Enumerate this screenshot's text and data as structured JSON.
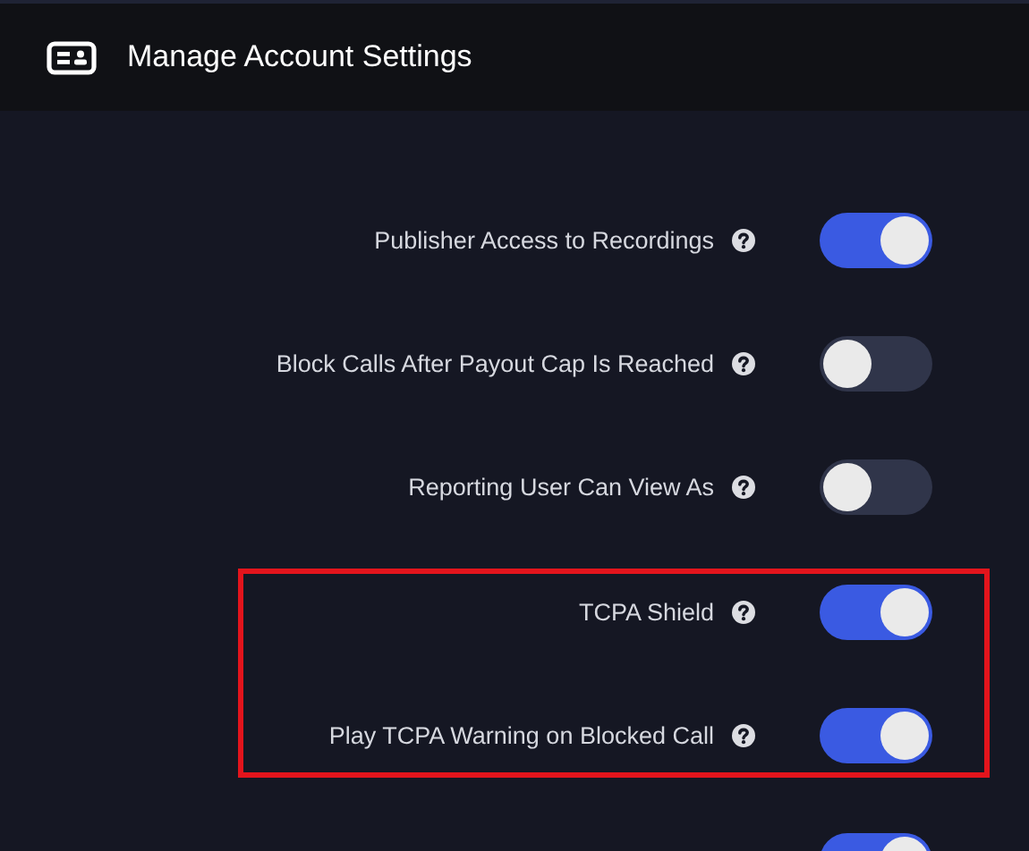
{
  "header": {
    "title": "Manage Account Settings"
  },
  "settings": [
    {
      "label": "Publisher Access to Recordings",
      "on": true,
      "highlighted": false
    },
    {
      "label": "Block Calls After Payout Cap Is Reached",
      "on": false,
      "highlighted": false
    },
    {
      "label": "Reporting User Can View As",
      "on": false,
      "highlighted": false
    },
    {
      "label": "TCPA Shield",
      "on": true,
      "highlighted": true
    },
    {
      "label": "Play TCPA Warning on Blocked Call",
      "on": true,
      "highlighted": true
    },
    {
      "on": true,
      "highlighted": false
    }
  ]
}
